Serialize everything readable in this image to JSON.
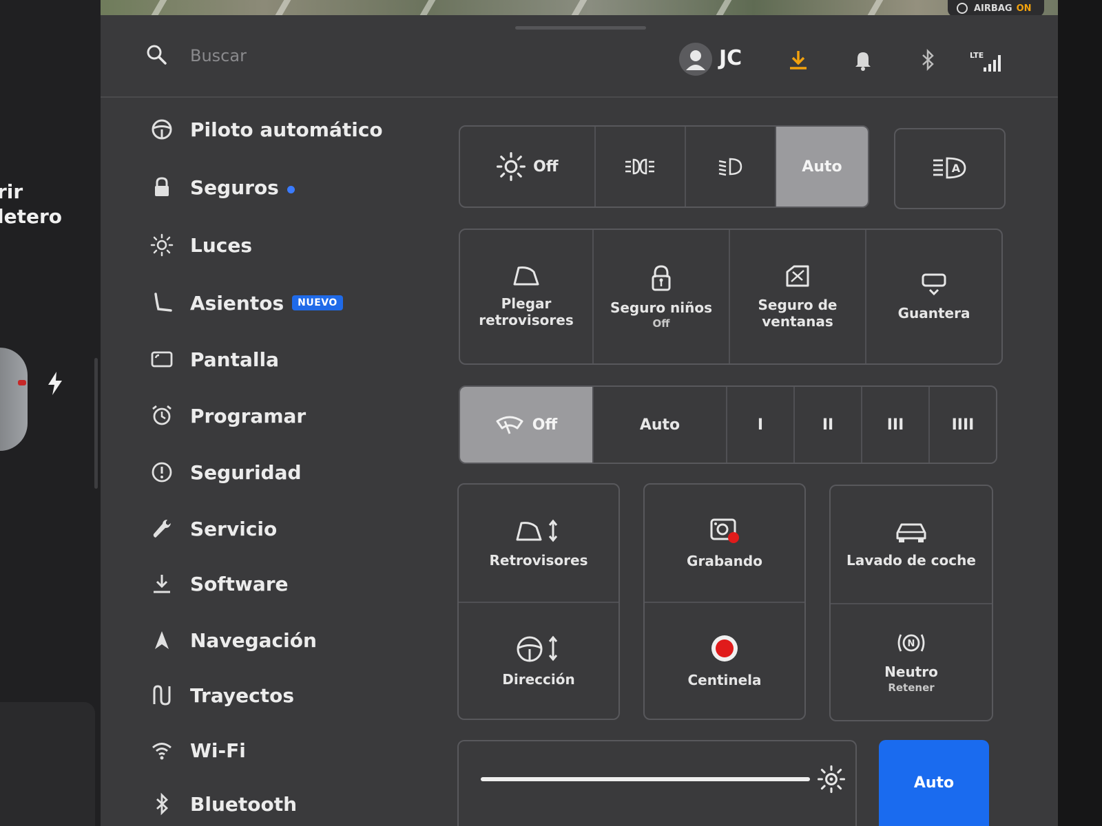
{
  "left_panel": {
    "line1": "rir",
    "line2": "letero"
  },
  "status": {
    "airbag_label": "AIRBAG",
    "airbag_state": "ON",
    "airbag_state_color": "#f2a20e",
    "network": "LTE"
  },
  "search": {
    "placeholder": "Buscar",
    "icon": "search-icon"
  },
  "user": {
    "initials": "JC"
  },
  "topbar_icons": [
    "download-icon",
    "bell-icon",
    "bluetooth-icon",
    "lte-signal-icon"
  ],
  "accent_color": "#1a6bef",
  "sidebar": {
    "items": [
      {
        "label": "Piloto automático",
        "icon": "steering-wheel-icon"
      },
      {
        "label": "Seguros",
        "icon": "lock-icon",
        "dot": true
      },
      {
        "label": "Luces",
        "icon": "light-icon"
      },
      {
        "label": "Asientos",
        "icon": "seat-icon",
        "badge": "NUEVO"
      },
      {
        "label": "Pantalla",
        "icon": "display-icon"
      },
      {
        "label": "Programar",
        "icon": "alarm-clock-icon"
      },
      {
        "label": "Seguridad",
        "icon": "alert-circle-icon"
      },
      {
        "label": "Servicio",
        "icon": "wrench-icon"
      },
      {
        "label": "Software",
        "icon": "download-icon"
      },
      {
        "label": "Navegación",
        "icon": "navigation-icon"
      },
      {
        "label": "Trayectos",
        "icon": "trips-icon"
      },
      {
        "label": "Wi-Fi",
        "icon": "wifi-icon"
      },
      {
        "label": "Bluetooth",
        "icon": "bluetooth-icon"
      }
    ]
  },
  "lights": {
    "options": [
      {
        "label": "Off",
        "icon": "sun-icon"
      },
      {
        "label": "",
        "icon": "parking-lights-icon"
      },
      {
        "label": "",
        "icon": "low-beam-icon"
      },
      {
        "label": "Auto",
        "icon": ""
      }
    ],
    "selected": "Auto",
    "auto_high_beam_icon": "auto-high-beam-icon"
  },
  "controls_row1": [
    {
      "label": "Plegar retrovisores",
      "icon": "mirror-fold-icon"
    },
    {
      "label": "Seguro niños",
      "sub": "Off",
      "icon": "child-lock-icon"
    },
    {
      "label": "Seguro de ventanas",
      "icon": "window-lock-icon"
    },
    {
      "label": "Guantera",
      "icon": "glovebox-icon"
    }
  ],
  "wipers": {
    "options": [
      "Off",
      "Auto",
      "I",
      "II",
      "III",
      "IIII"
    ],
    "selected": "Off",
    "icon": "wiper-icon"
  },
  "controls_grid": [
    {
      "label": "Retrovisores",
      "icon": "mirror-adjust-icon"
    },
    {
      "label": "Grabando",
      "icon": "dashcam-icon"
    },
    {
      "label": "Lavado de coche",
      "icon": "car-wash-icon"
    },
    {
      "label": "Dirección",
      "icon": "steering-adjust-icon"
    },
    {
      "label": "Centinela",
      "icon": "sentry-icon"
    },
    {
      "label": "Neutro",
      "sub": "Retener",
      "icon": "neutral-icon"
    }
  ],
  "display_brightness": {
    "level": 1.0,
    "icon": "brightness-icon",
    "auto_label": "Auto"
  }
}
